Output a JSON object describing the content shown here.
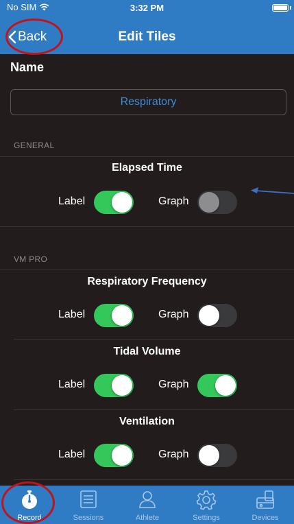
{
  "status_bar": {
    "carrier": "No SIM",
    "time": "3:32 PM"
  },
  "nav": {
    "back_label": "Back",
    "title": "Edit Tiles"
  },
  "name_section": {
    "label": "Name",
    "value": "Respiratory"
  },
  "sections": [
    {
      "header": "GENERAL",
      "tiles": [
        {
          "title": "Elapsed Time",
          "label_text": "Label",
          "graph_text": "Graph",
          "label_on": true,
          "graph_on": false,
          "graph_disabled": true
        }
      ]
    },
    {
      "header": "VM PRO",
      "tiles": [
        {
          "title": "Respiratory Frequency",
          "label_text": "Label",
          "graph_text": "Graph",
          "label_on": true,
          "graph_on": false
        },
        {
          "title": "Tidal Volume",
          "label_text": "Label",
          "graph_text": "Graph",
          "label_on": true,
          "graph_on": true
        },
        {
          "title": "Ventilation",
          "label_text": "Label",
          "graph_text": "Graph",
          "label_on": true,
          "graph_on": false
        }
      ]
    }
  ],
  "tab_bar": {
    "active": "Record",
    "tabs": [
      {
        "label": "Record",
        "icon": "stopwatch-icon"
      },
      {
        "label": "Sessions",
        "icon": "list-icon"
      },
      {
        "label": "Athlete",
        "icon": "person-icon"
      },
      {
        "label": "Settings",
        "icon": "gear-icon"
      },
      {
        "label": "Devices",
        "icon": "devices-icon"
      }
    ]
  },
  "colors": {
    "nav_blue": "#2f7bc4",
    "background": "#221d1c",
    "toggle_on": "#34c759",
    "toggle_off": "#3a3a3c",
    "input_text": "#3d8bd6",
    "annotation_red": "#c0141a",
    "annotation_arrow": "#3e6fc2"
  }
}
